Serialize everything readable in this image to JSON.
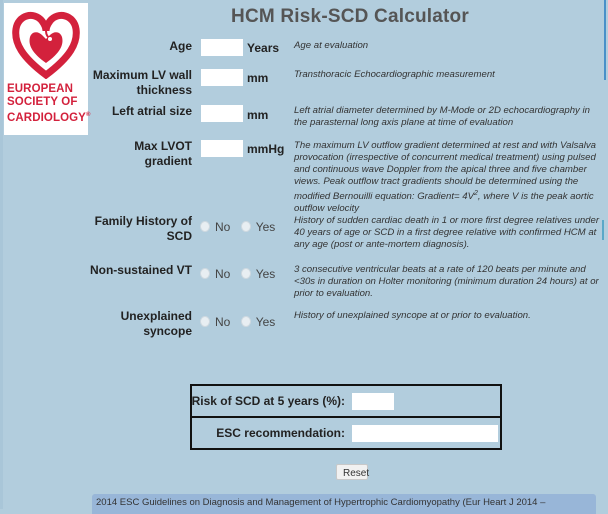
{
  "logo": {
    "org_line1": "EUROPEAN",
    "org_line2": "SOCIETY OF",
    "org_line3": "CARDIOLOGY",
    "registered": "®",
    "colors": {
      "brand_red": "#d3213c"
    }
  },
  "title": "HCM Risk-SCD Calculator",
  "fields": [
    {
      "label": "Age",
      "value": "",
      "unit": "Years",
      "description": "Age at evaluation"
    },
    {
      "label_line1": "Maximum LV wall",
      "label_line2": "thickness",
      "value": "",
      "unit": "mm",
      "description": "Transthoracic Echocardiographic measurement"
    },
    {
      "label": "Left atrial size",
      "value": "",
      "unit": "mm",
      "description": "Left atrial diameter determined by M-Mode or 2D echocardiography in the parasternal long axis plane at time of evaluation"
    },
    {
      "label_line1": "Max LVOT",
      "label_line2": "gradient",
      "value": "",
      "unit": "mmHg",
      "description_main": "The maximum LV outflow gradient determined at rest and with Valsalva provocation (irrespective of concurrent medical treatment) using pulsed and continuous wave Doppler from the apical three and five chamber views. Peak outflow tract gradients should be determined using the modified Bernouilli equation: Gradient= 4V",
      "description_sup": "2",
      "description_tail": ", where V is the peak aortic outflow velocity"
    }
  ],
  "radio_fields": [
    {
      "label_line1": "Family History of",
      "label_line2": "SCD",
      "options": [
        "No",
        "Yes"
      ],
      "selected": null,
      "description": "History of sudden cardiac death in 1 or more first degree relatives under 40 years of age or SCD in a first degree relative with confirmed HCM at any age (post or ante-mortem diagnosis)."
    },
    {
      "label": "Non-sustained VT",
      "options": [
        "No",
        "Yes"
      ],
      "selected": null,
      "description": "3 consecutive ventricular beats at a rate of 120 beats per minute and <30s in duration on Holter monitoring (minimum duration 24 hours) at or prior to evaluation."
    },
    {
      "label_line1": "Unexplained",
      "label_line2": "syncope",
      "options": [
        "No",
        "Yes"
      ],
      "selected": null,
      "description": "History of unexplained syncope at or prior to evaluation."
    }
  ],
  "results": {
    "risk_label": "Risk of SCD at 5 years (%):",
    "risk_value": "",
    "recommendation_label": "ESC recommendation:",
    "recommendation_value": ""
  },
  "reset_label": "Reset",
  "footer_text": "2014 ESC Guidelines on Diagnosis and Management of Hypertrophic Cardiomyopathy (Eur Heart J 2014 –",
  "colors": {
    "background": "#b2cddd",
    "footer_band": "#98b6d8",
    "title_text": "#555555"
  }
}
